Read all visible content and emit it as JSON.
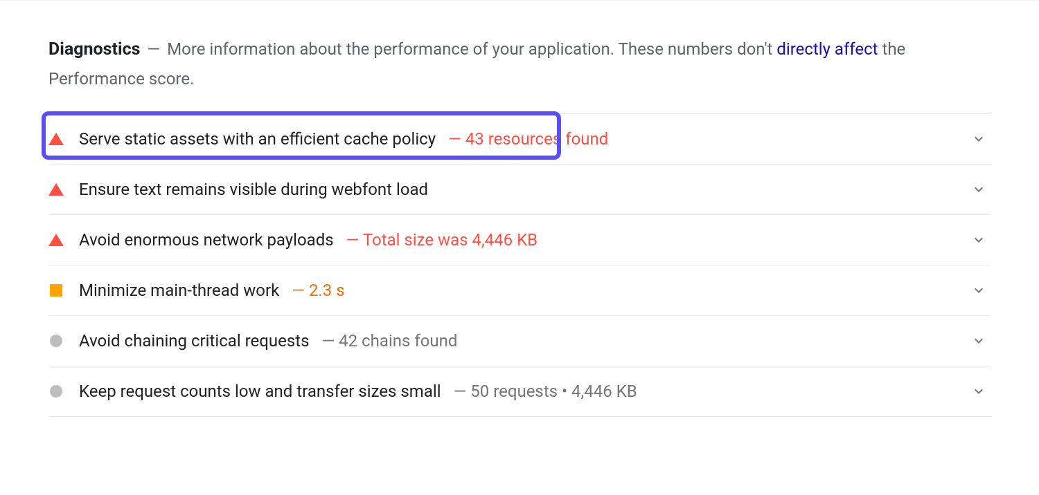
{
  "header": {
    "title": "Diagnostics",
    "text_part1": "More information about the performance of your application. These numbers don't ",
    "link_text": "directly affect",
    "text_part2": " the Performance score."
  },
  "detail_separators": {
    "red_orange": "— ",
    "gray": "— "
  },
  "diagnostics": [
    {
      "icon": "triangle",
      "title": "Serve static assets with an efficient cache policy",
      "detail": "43 resources found",
      "detail_class": "detail-red",
      "highlighted": true
    },
    {
      "icon": "triangle",
      "title": "Ensure text remains visible during webfont load",
      "detail": "",
      "detail_class": "",
      "highlighted": false
    },
    {
      "icon": "triangle",
      "title": "Avoid enormous network payloads",
      "detail": "Total size was 4,446 KB",
      "detail_class": "detail-red",
      "highlighted": false
    },
    {
      "icon": "square",
      "title": "Minimize main-thread work",
      "detail": "2.3 s",
      "detail_class": "detail-orange",
      "highlighted": false
    },
    {
      "icon": "circle",
      "title": "Avoid chaining critical requests",
      "detail": "42 chains found",
      "detail_class": "detail-gray",
      "highlighted": false
    },
    {
      "icon": "circle",
      "title": "Keep request counts low and transfer sizes small",
      "detail": "50 requests • 4,446 KB",
      "detail_class": "detail-gray",
      "highlighted": false
    }
  ]
}
